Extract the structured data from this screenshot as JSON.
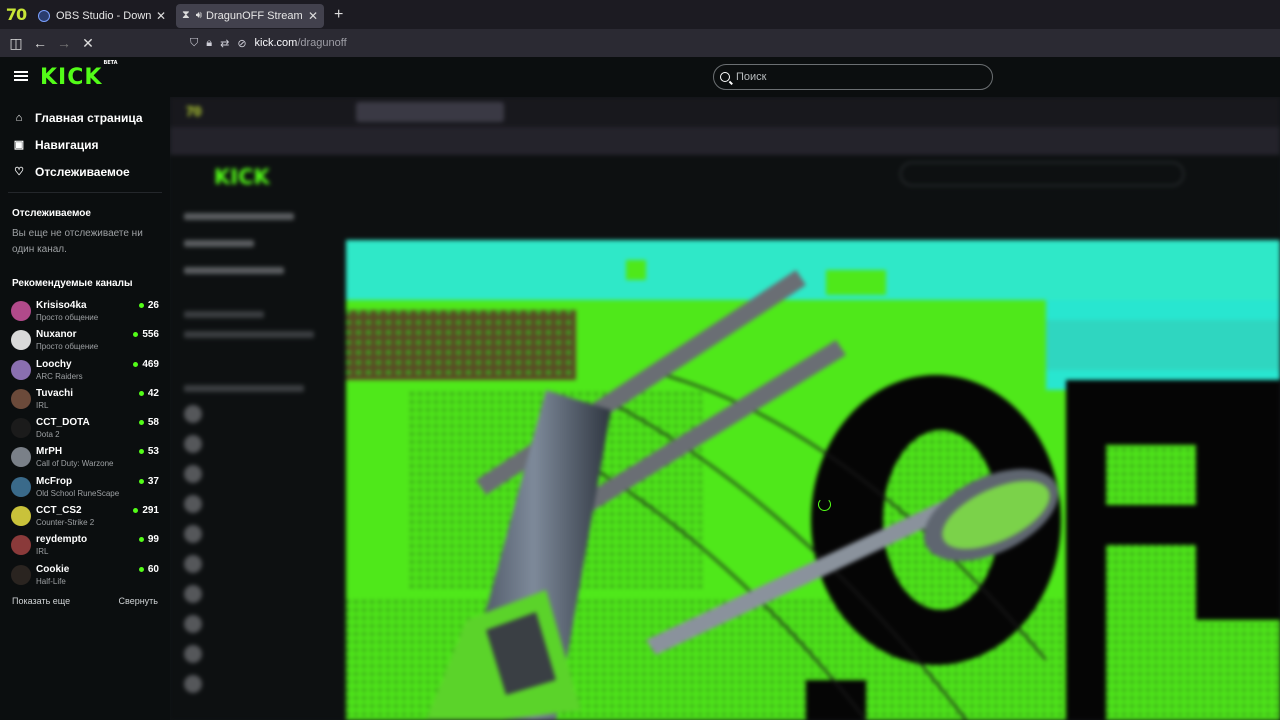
{
  "browser": {
    "tabs": [
      {
        "title": "OBS Studio - Download and ins",
        "favicon": "obs-icon",
        "active": false
      },
      {
        "title": "DragunOFF Stream - Watch",
        "favicon": "hourglass-icon",
        "active": true
      }
    ],
    "url_domain": "kick.com",
    "url_path": "/dragunoff"
  },
  "kick": {
    "logo": "KICK",
    "logo_badge": "BETA",
    "search_placeholder": "Поиск",
    "nav": [
      {
        "label": "Главная страница",
        "icon": "home-icon"
      },
      {
        "label": "Навигация",
        "icon": "browse-icon"
      },
      {
        "label": "Отслеживаемое",
        "icon": "heart-icon"
      }
    ],
    "following": {
      "title": "Отслеживаемое",
      "empty_text": "Вы еще не отслеживаете ни один канал."
    },
    "recommended": {
      "title": "Рекомендуемые каналы",
      "channels": [
        {
          "name": "Krisiso4ka",
          "category": "Просто общение",
          "viewers": "26",
          "avatar_color": "#b14a8a"
        },
        {
          "name": "Nuxanor",
          "category": "Просто общение",
          "viewers": "556",
          "avatar_color": "#d9d9d9"
        },
        {
          "name": "Loochy",
          "category": "ARC Raiders",
          "viewers": "469",
          "avatar_color": "#8a6fb0"
        },
        {
          "name": "Tuvachi",
          "category": "IRL",
          "viewers": "42",
          "avatar_color": "#6b4a3a"
        },
        {
          "name": "CCT_DOTA",
          "category": "Dota 2",
          "viewers": "58",
          "avatar_color": "#1b1b1b"
        },
        {
          "name": "MrPH",
          "category": "Call of Duty: Warzone",
          "viewers": "53",
          "avatar_color": "#7a8088"
        },
        {
          "name": "McFrop",
          "category": "Old School RuneScape",
          "viewers": "37",
          "avatar_color": "#3a6a8a"
        },
        {
          "name": "CCT_CS2",
          "category": "Counter-Strike 2",
          "viewers": "291",
          "avatar_color": "#c9c23a"
        },
        {
          "name": "reydempto",
          "category": "IRL",
          "viewers": "99",
          "avatar_color": "#8a3a3a"
        },
        {
          "name": "Cookie",
          "category": "Half-Life",
          "viewers": "60",
          "avatar_color": "#2a2420"
        }
      ]
    },
    "show_more": "Показать еще",
    "collapse": "Свернуть"
  },
  "colors": {
    "accent": "#53fc18",
    "bg": "#0b0e0f",
    "art_cyan": "#28e6d0",
    "art_green": "#4fe81a"
  }
}
